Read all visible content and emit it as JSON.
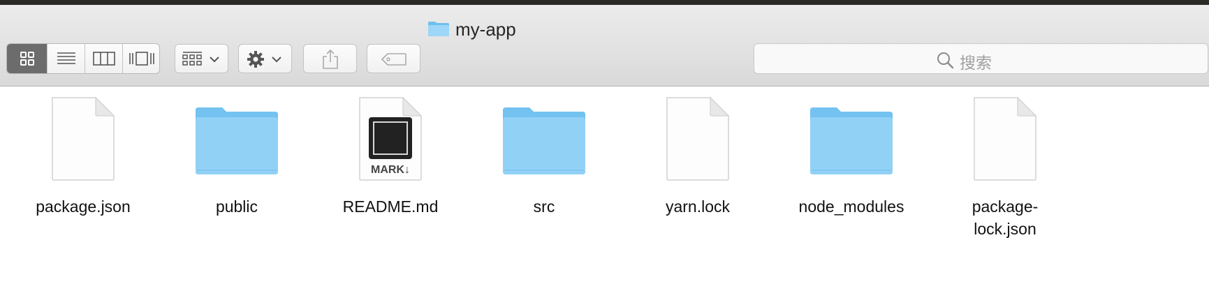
{
  "window": {
    "title": "my-app"
  },
  "toolbar": {
    "view_modes": [
      "icon-view",
      "list-view",
      "column-view",
      "cover-flow-view"
    ],
    "active_view": "icon-view",
    "search_placeholder": "搜索"
  },
  "files": [
    {
      "name": "package.json",
      "kind": "document"
    },
    {
      "name": "public",
      "kind": "folder"
    },
    {
      "name": "README.md",
      "kind": "markdown",
      "badge": "MARK↓"
    },
    {
      "name": "src",
      "kind": "folder"
    },
    {
      "name": "yarn.lock",
      "kind": "document"
    },
    {
      "name": "node_modules",
      "kind": "folder"
    },
    {
      "name": "package-lock.json",
      "kind": "document"
    }
  ],
  "colors": {
    "folder": "#8fcff5",
    "toolbar": "#e3e3e3",
    "active_segment": "#6c6c6c"
  }
}
